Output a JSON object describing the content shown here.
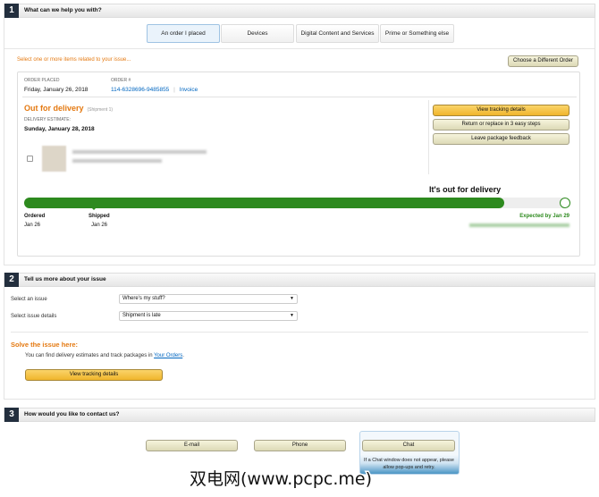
{
  "section1": {
    "number": "1",
    "title": "What can we help you with?",
    "tabs": [
      {
        "label": "An order I placed",
        "selected": true
      },
      {
        "label": "Devices"
      },
      {
        "label": "Digital Content and Services"
      },
      {
        "label": "Prime or Something else"
      }
    ],
    "select_items_prompt": "Select one or more items related to your issue...",
    "choose_order_button": "Choose a Different Order",
    "order": {
      "placed_label": "ORDER PLACED",
      "placed_date": "Friday, January 26, 2018",
      "number_label": "ORDER #",
      "number": "114-6328696-9485855",
      "separator": "|",
      "invoice_link": "Invoice",
      "status": "Out for delivery",
      "shipment": "(Shipment 1)",
      "estimate_label": "DELIVERY ESTIMATE:",
      "estimate_date": "Sunday, January 28, 2018",
      "actions": [
        "View tracking details",
        "Return or replace in 3 easy steps",
        "Leave package feedback"
      ],
      "tracking": {
        "headline": "It's out for delivery",
        "progress_percent": 88,
        "steps": [
          {
            "label": "Ordered",
            "date": "Jan 26"
          },
          {
            "label": "Shipped",
            "date": "Jan 26"
          }
        ],
        "expected": "Expected by Jan 29",
        "accent": "#2d8a1e"
      }
    }
  },
  "section2": {
    "number": "2",
    "title": "Tell us more about your issue",
    "issue_label": "Select an issue",
    "issue_value": "Where's my stuff?",
    "details_label": "Select issue details",
    "details_value": "Shipment is late",
    "solve_heading": "Solve the issue here:",
    "solve_text": "You can find delivery estimates and track packages in ",
    "solve_link": "Your Orders",
    "solve_period": ".",
    "button": "View tracking details"
  },
  "section3": {
    "number": "3",
    "title": "How would you like to contact us?",
    "buttons": [
      "E-mail",
      "Phone",
      "Chat"
    ],
    "chat_note": "If a Chat window does not appear, please allow pop-ups and retry."
  },
  "watermark": "双电网(www.pcpc.me)",
  "colors": {
    "orange": "#e47911",
    "green": "#2d8a1e",
    "dark": "#232f3e",
    "link": "#0066c0"
  }
}
